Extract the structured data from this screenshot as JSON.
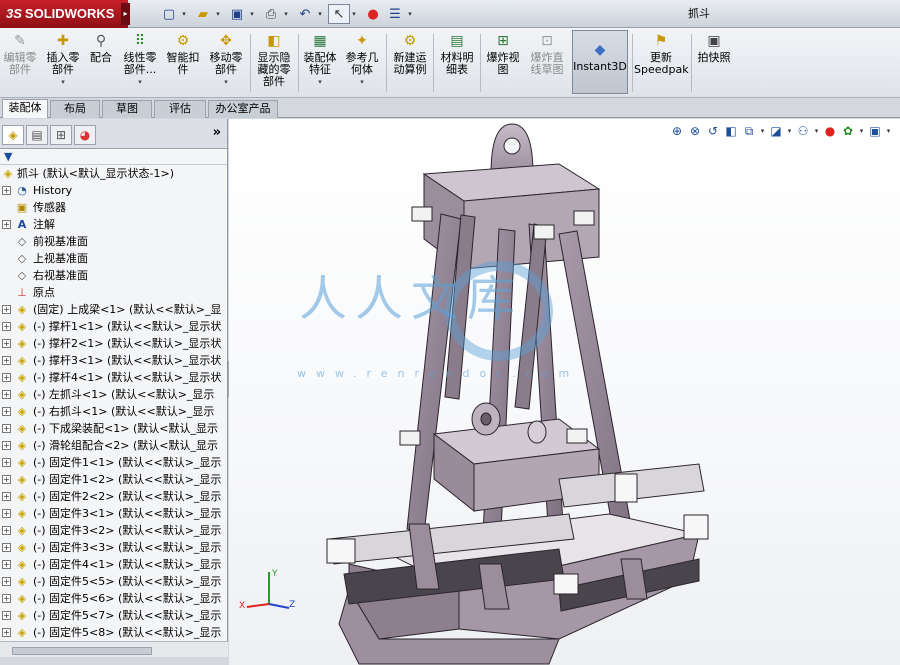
{
  "app": {
    "brand_mark": "3S",
    "brand_name": "SOLIDWORKS",
    "document_title": "抓斗"
  },
  "colors": {
    "brand_red": "#b0171f",
    "part_yellow": "#c9a600",
    "model_purple": "#8e7f8f",
    "watermark_blue": "#5aa0d7"
  },
  "commands": [
    {
      "label": "编辑零部件",
      "icon": "edit-component-icon",
      "disabled": true
    },
    {
      "label": "插入零部件",
      "icon": "insert-component-icon"
    },
    {
      "label": "配合",
      "icon": "mate-icon"
    },
    {
      "label": "线性零部件...",
      "icon": "linear-pattern-icon"
    },
    {
      "label": "智能扣件",
      "icon": "smart-fastener-icon"
    },
    {
      "label": "移动零部件",
      "icon": "move-component-icon"
    },
    {
      "label": "显示隐藏的零部件",
      "icon": "show-hidden-icon"
    },
    {
      "label": "装配体特征",
      "icon": "assembly-feature-icon"
    },
    {
      "label": "参考几何体",
      "icon": "reference-geometry-icon"
    },
    {
      "label": "新建运动算例",
      "icon": "motion-study-icon"
    },
    {
      "label": "材料明细表",
      "icon": "bom-icon"
    },
    {
      "label": "爆炸视图",
      "icon": "exploded-view-icon"
    },
    {
      "label": "爆炸直线草图",
      "icon": "explode-line-sketch-icon",
      "disabled": true
    },
    {
      "label": "Instant3D",
      "icon": "instant3d-icon",
      "active": true
    },
    {
      "label": "更新Speedpak",
      "icon": "speedpak-icon"
    },
    {
      "label": "拍快照",
      "icon": "snapshot-icon"
    }
  ],
  "tabs": [
    "装配体",
    "布局",
    "草图",
    "评估",
    "办公室产品"
  ],
  "active_tab": 0,
  "tree": {
    "root": "抓斗 (默认<默认_显示状态-1>)",
    "items": [
      {
        "label": "History",
        "icon": "history-icon",
        "expandable": true
      },
      {
        "label": "传感器",
        "icon": "sensor-icon",
        "expandable": false
      },
      {
        "label": "注解",
        "icon": "annotation-icon",
        "expandable": true
      },
      {
        "label": "前视基准面",
        "icon": "plane-icon",
        "expandable": false
      },
      {
        "label": "上视基准面",
        "icon": "plane-icon",
        "expandable": false
      },
      {
        "label": "右视基准面",
        "icon": "plane-icon",
        "expandable": false
      },
      {
        "label": "原点",
        "icon": "origin-icon",
        "expandable": false
      },
      {
        "label": "(固定) 上成梁<1> (默认<<默认>_显",
        "icon": "part-icon",
        "expandable": true
      },
      {
        "label": "(-) 撑杆1<1> (默认<<默认>_显示状",
        "icon": "part-icon",
        "expandable": true
      },
      {
        "label": "(-) 撑杆2<1> (默认<<默认>_显示状",
        "icon": "part-icon",
        "expandable": true
      },
      {
        "label": "(-) 撑杆3<1> (默认<<默认>_显示状",
        "icon": "part-icon",
        "expandable": true
      },
      {
        "label": "(-) 撑杆4<1> (默认<<默认>_显示状",
        "icon": "part-icon",
        "expandable": true
      },
      {
        "label": "(-) 左抓斗<1> (默认<<默认>_显示",
        "icon": "part-icon",
        "expandable": true
      },
      {
        "label": "(-) 右抓斗<1> (默认<<默认>_显示",
        "icon": "part-icon",
        "expandable": true
      },
      {
        "label": "(-) 下成梁装配<1> (默认<默认_显示",
        "icon": "assembly-icon",
        "expandable": true
      },
      {
        "label": "(-) 滑轮组配合<2> (默认<默认_显示",
        "icon": "assembly-icon",
        "expandable": true
      },
      {
        "label": "(-) 固定件1<1> (默认<<默认>_显示",
        "icon": "part-icon",
        "expandable": true
      },
      {
        "label": "(-) 固定件1<2> (默认<<默认>_显示",
        "icon": "part-icon",
        "expandable": true
      },
      {
        "label": "(-) 固定件2<2> (默认<<默认>_显示",
        "icon": "part-icon",
        "expandable": true
      },
      {
        "label": "(-) 固定件3<1> (默认<<默认>_显示",
        "icon": "part-icon",
        "expandable": true
      },
      {
        "label": "(-) 固定件3<2> (默认<<默认>_显示",
        "icon": "part-icon",
        "expandable": true
      },
      {
        "label": "(-) 固定件3<3> (默认<<默认>_显示",
        "icon": "part-icon",
        "expandable": true
      },
      {
        "label": "(-) 固定件4<1> (默认<<默认>_显示",
        "icon": "part-icon",
        "expandable": true
      },
      {
        "label": "(-) 固定件5<5> (默认<<默认>_显示",
        "icon": "part-icon",
        "expandable": true
      },
      {
        "label": "(-) 固定件5<6> (默认<<默认>_显示",
        "icon": "part-icon",
        "expandable": true
      },
      {
        "label": "(-) 固定件5<7> (默认<<默认>_显示",
        "icon": "part-icon",
        "expandable": true
      },
      {
        "label": "(-) 固定件5<8> (默认<<默认>_显示",
        "icon": "part-icon",
        "expandable": true
      }
    ]
  },
  "watermark": {
    "text": "人人文库",
    "url": "www.renrendoc.com"
  },
  "triad": {
    "x": "X",
    "y": "Y",
    "z": "Z"
  }
}
